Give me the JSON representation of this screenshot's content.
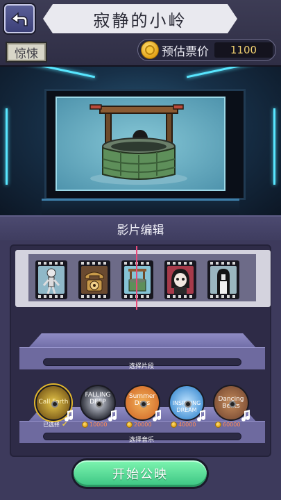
{
  "header": {
    "title": "寂静的小岭",
    "genre_tag": "惊悚",
    "price_label": "预估票价",
    "price_value": "1100"
  },
  "editor": {
    "panel_title": "影片编辑",
    "clip_shelf_label": "选择片段",
    "music_shelf_label": "选择音乐",
    "clips": [
      {
        "icon": "skeleton-icon"
      },
      {
        "icon": "rotary-phone-icon"
      },
      {
        "icon": "well-icon"
      },
      {
        "icon": "ghost-girl-icon"
      },
      {
        "icon": "long-hair-ghost-icon"
      }
    ],
    "music": [
      {
        "label": "Call Forth",
        "status": "已选择",
        "selected": true,
        "colors": [
          "#e8c84a",
          "#6b4b12"
        ]
      },
      {
        "label": "FALLING DEEP",
        "price": "10000",
        "selected": false,
        "colors": [
          "#d8dde8",
          "#1c1e28"
        ]
      },
      {
        "label": "Summer Days",
        "price": "20000",
        "selected": false,
        "colors": [
          "#f3b25a",
          "#d36c2a"
        ]
      },
      {
        "label": "INSPIRING DREAM",
        "price": "40000",
        "selected": false,
        "colors": [
          "#bfe3ff",
          "#3a8ad0"
        ]
      },
      {
        "label": "Dancing Beats",
        "price": "60000",
        "selected": false,
        "colors": [
          "#c48a5a",
          "#7a4c34"
        ]
      }
    ]
  },
  "actions": {
    "start_label": "开始公映"
  },
  "colors": {
    "accent_green": "#4fd592",
    "panel": "#3d3a5c",
    "price_red": "#ff8a5a"
  }
}
